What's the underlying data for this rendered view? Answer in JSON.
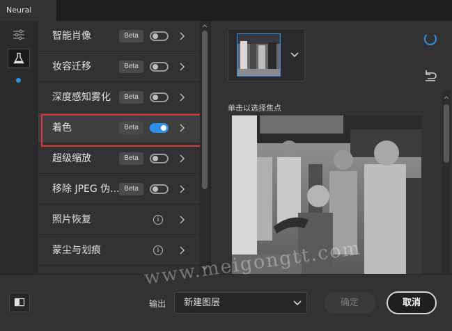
{
  "window": {
    "tab_title": "Neural Filters"
  },
  "filters": [
    {
      "label": "智能肖像",
      "beta": "Beta",
      "control": "toggle",
      "on": false
    },
    {
      "label": "妆容迁移",
      "beta": "Beta",
      "control": "toggle",
      "on": false
    },
    {
      "label": "深度感知雾化",
      "beta": "Beta",
      "control": "toggle",
      "on": false
    },
    {
      "label": "着色",
      "beta": "Beta",
      "control": "toggle",
      "on": true,
      "selected": true
    },
    {
      "label": "超级缩放",
      "beta": "Beta",
      "control": "toggle",
      "on": false
    },
    {
      "label": "移除 JPEG 伪...",
      "beta": "Beta",
      "control": "toggle",
      "on": false
    },
    {
      "label": "照片恢复",
      "control": "info"
    },
    {
      "label": "蒙尘与划痕",
      "control": "info"
    }
  ],
  "preview": {
    "focus_label": "单击以选择焦点"
  },
  "footer": {
    "output_label": "输出",
    "output_value": "新建图层",
    "ok_label": "确定",
    "cancel_label": "取消"
  },
  "watermark": "www.meigongtt.com",
  "colors": {
    "accent": "#2f8fe8",
    "highlight": "#e0383b"
  },
  "info_glyph": "i"
}
